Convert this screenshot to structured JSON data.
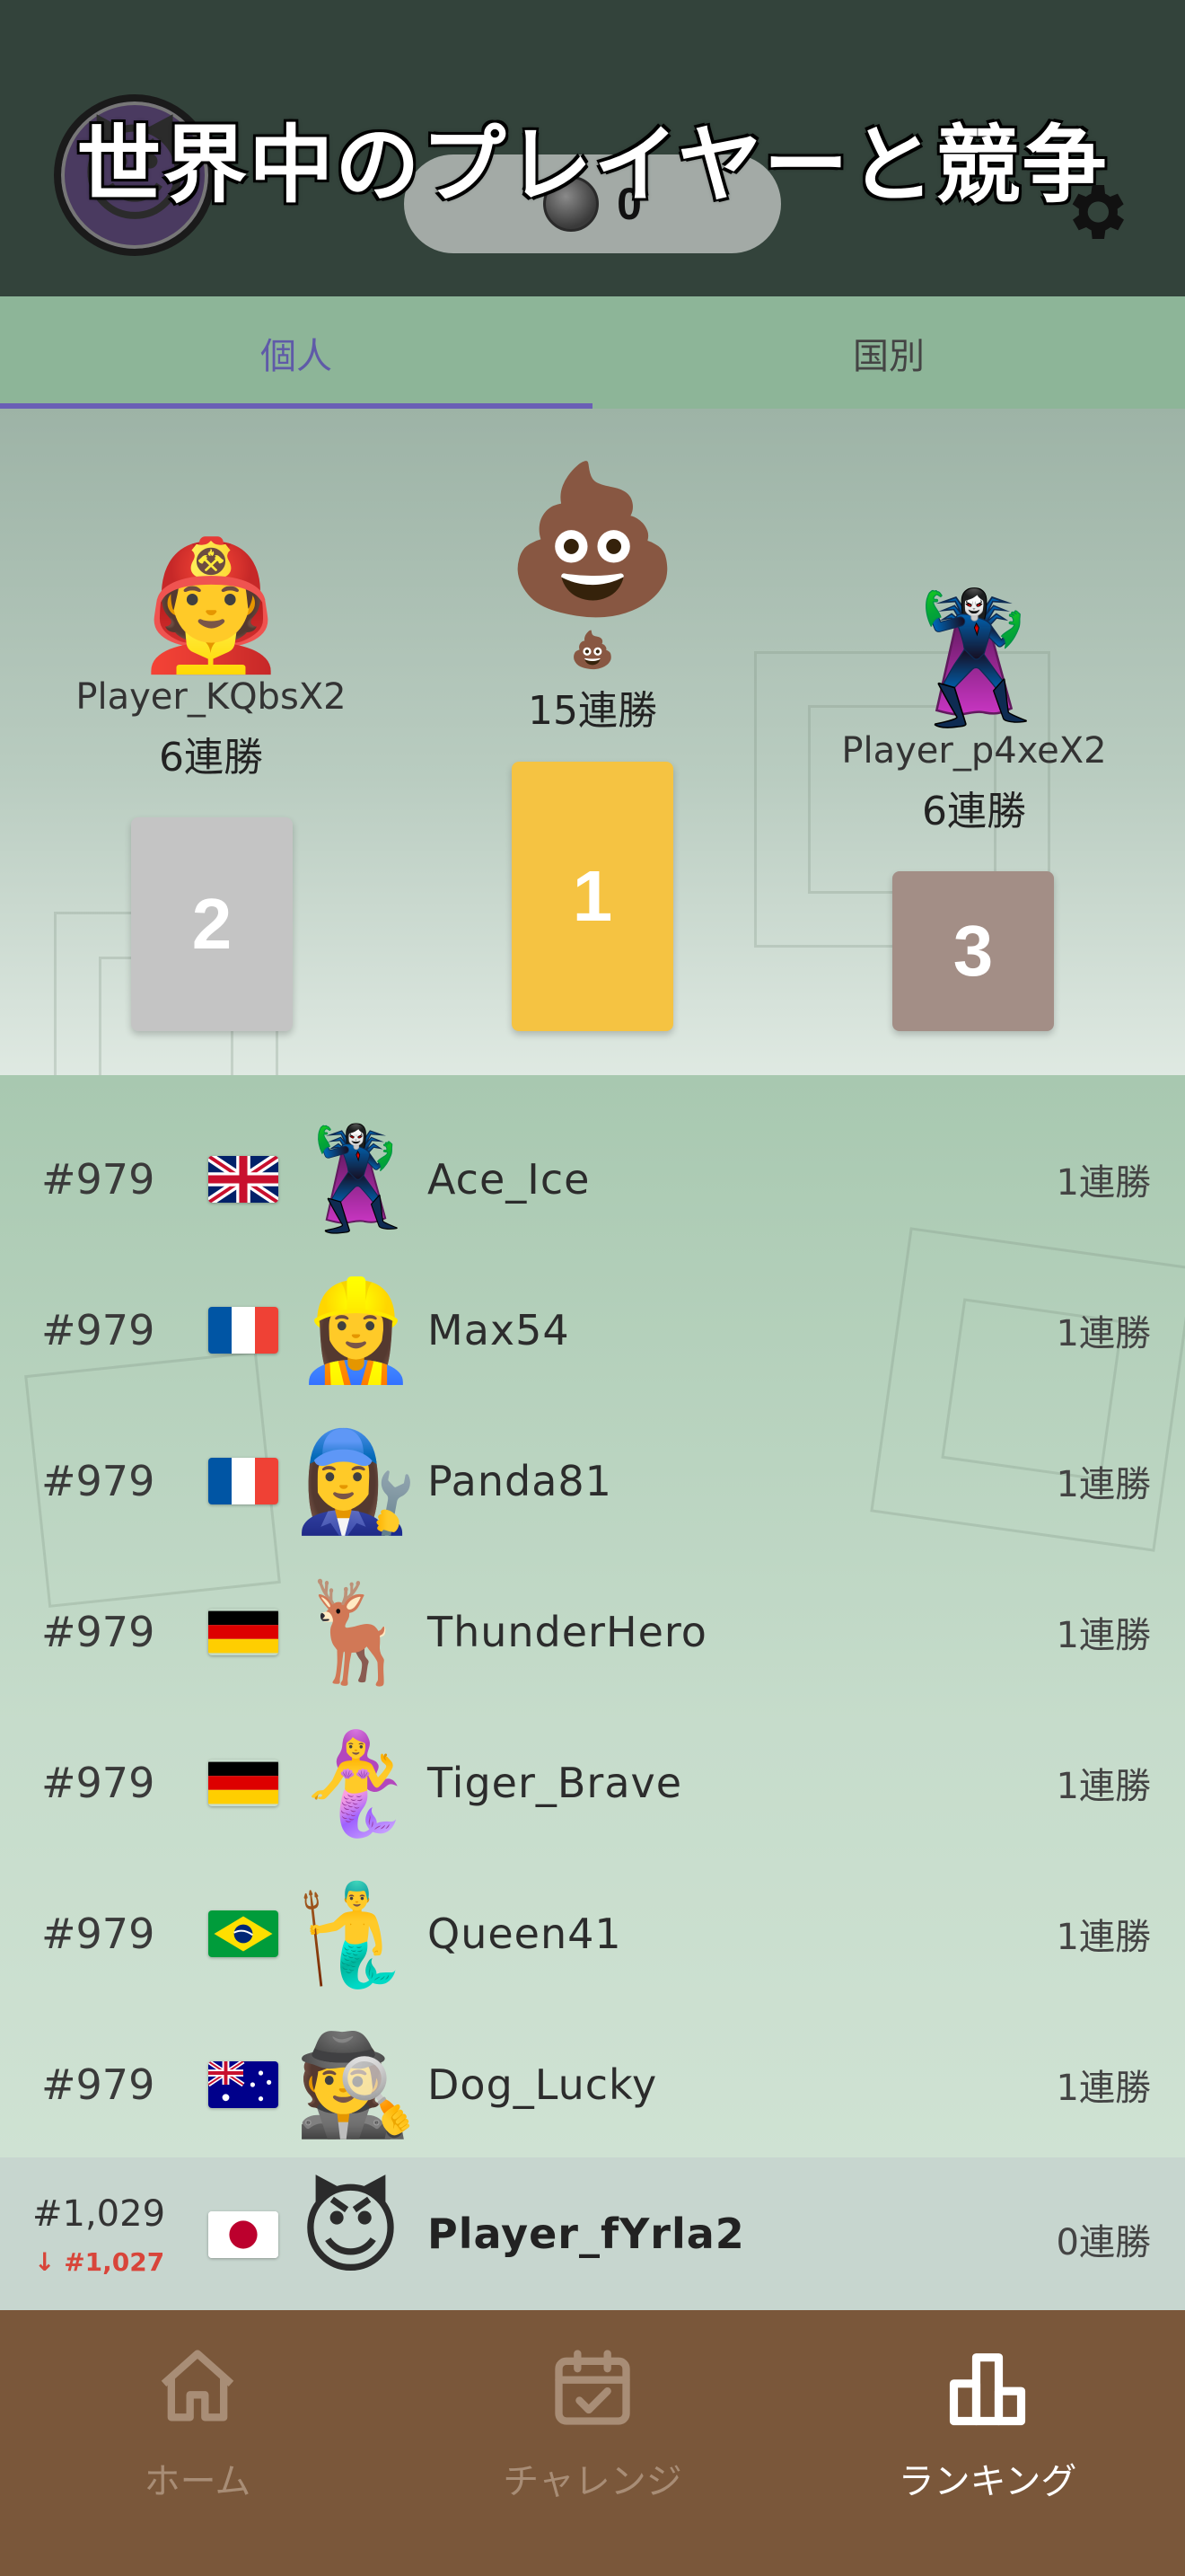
{
  "header": {
    "headline": "世界中のプレイヤーと競争",
    "coin_count": "0",
    "avatar_emoji": "😈"
  },
  "tabs": [
    {
      "label": "個人",
      "active": true
    },
    {
      "label": "国別",
      "active": false
    }
  ],
  "podium": {
    "first": {
      "rank": "1",
      "emoji": "💩",
      "badge": "💩",
      "streak": "15連勝"
    },
    "second": {
      "rank": "2",
      "emoji": "🧑‍🚒",
      "name": "Player_KQbsX2",
      "streak": "6連勝"
    },
    "third": {
      "rank": "3",
      "emoji": "🦹‍♀️",
      "name": "Player_p4xeX2",
      "streak": "6連勝"
    }
  },
  "leaderboard": [
    {
      "rank": "#979",
      "flag": "gb",
      "emoji": "🦹‍♀️",
      "name": "Ace_Ice",
      "wins": "1連勝"
    },
    {
      "rank": "#979",
      "flag": "fr",
      "emoji": "👷‍♀️",
      "name": "Max54",
      "wins": "1連勝"
    },
    {
      "rank": "#979",
      "flag": "fr",
      "emoji": "👩‍🔧",
      "name": "Panda81",
      "wins": "1連勝"
    },
    {
      "rank": "#979",
      "flag": "de",
      "emoji": "🦌",
      "name": "ThunderHero",
      "wins": "1連勝"
    },
    {
      "rank": "#979",
      "flag": "de",
      "emoji": "🧜‍♀️",
      "name": "Tiger_Brave",
      "wins": "1連勝"
    },
    {
      "rank": "#979",
      "flag": "br",
      "emoji": "🧜‍♂️",
      "name": "Queen41",
      "wins": "1連勝"
    },
    {
      "rank": "#979",
      "flag": "au",
      "emoji": "🕵️",
      "name": "Dog_Lucky",
      "wins": "1連勝"
    }
  ],
  "current_user": {
    "rank": "#1,029",
    "best_rank": "↓ #1,027",
    "flag": "jp",
    "emoji": "😈",
    "name": "Player_fYrla2",
    "wins": "0連勝"
  },
  "bottom_nav": [
    {
      "label": "ホーム",
      "icon": "home-icon",
      "active": false
    },
    {
      "label": "チャレンジ",
      "icon": "calendar-check-icon",
      "active": false
    },
    {
      "label": "ランキング",
      "icon": "bar-chart-icon",
      "active": true
    }
  ],
  "colors": {
    "header_bg": "#33433b",
    "tab_bg": "#8db598",
    "tab_active": "#5f5aa8",
    "gold": "#f5c342",
    "silver": "#c4c4c4",
    "bronze": "#a38e86",
    "nav_bg": "#7a573a",
    "rank_drop": "#d8453a"
  }
}
